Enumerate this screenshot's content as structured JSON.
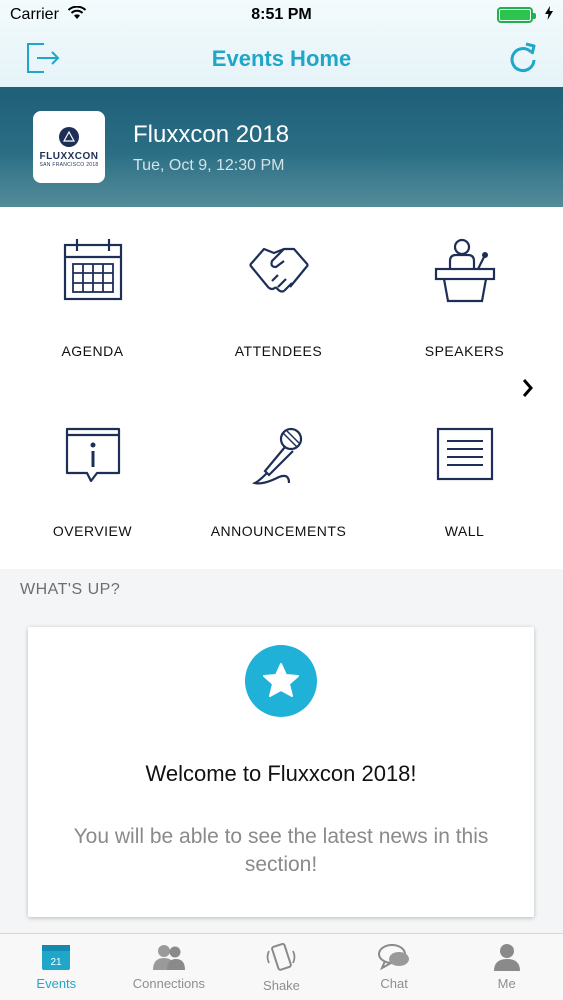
{
  "status_bar": {
    "carrier": "Carrier",
    "time": "8:51 PM",
    "battery_level": 1.0
  },
  "nav": {
    "title": "Events Home",
    "left_icon": "logout-icon",
    "right_icon": "refresh-icon"
  },
  "event": {
    "name": "Fluxxcon 2018",
    "date": "Tue, Oct 9, 12:30 PM",
    "logo_text": "FLUXXCON",
    "logo_sub": "SAN FRANCISCO 2018"
  },
  "grid": {
    "items": [
      {
        "label": "AGENDA",
        "icon": "calendar-icon"
      },
      {
        "label": "ATTENDEES",
        "icon": "handshake-icon"
      },
      {
        "label": "SPEAKERS",
        "icon": "podium-icon"
      },
      {
        "label": "OVERVIEW",
        "icon": "info-icon"
      },
      {
        "label": "ANNOUNCEMENTS",
        "icon": "microphone-icon"
      },
      {
        "label": "WALL",
        "icon": "wall-icon"
      }
    ]
  },
  "whats_up": {
    "title": "WHAT'S UP?",
    "card_title": "Welcome to Fluxxcon 2018!",
    "card_body": "You will be able to see the latest news in this section!"
  },
  "tabs": [
    {
      "label": "Events",
      "icon": "calendar-icon",
      "badge": "21",
      "active": true
    },
    {
      "label": "Connections",
      "icon": "people-icon",
      "active": false
    },
    {
      "label": "Shake",
      "icon": "shake-phone-icon",
      "active": false
    },
    {
      "label": "Chat",
      "icon": "chat-icon",
      "active": false
    },
    {
      "label": "Me",
      "icon": "person-icon",
      "active": false
    }
  ],
  "colors": {
    "accent": "#1fa6c9",
    "header_bg": "#25657c",
    "icon_navy": "#1e2f57"
  }
}
